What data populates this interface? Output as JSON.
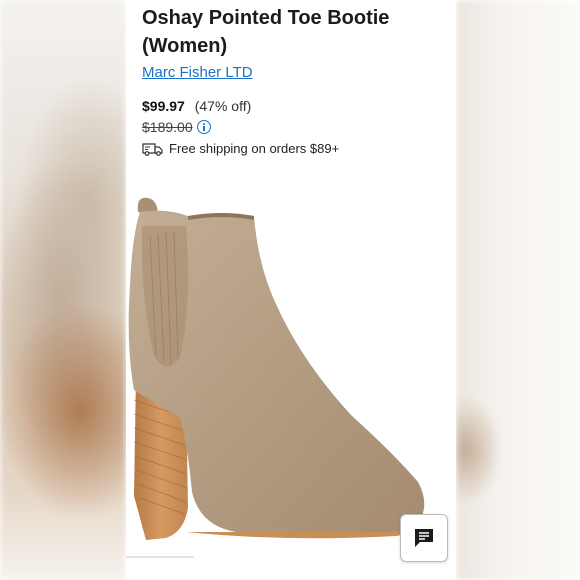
{
  "product": {
    "title": "Oshay Pointed Toe Bootie (Women)",
    "brand": "Marc Fisher LTD",
    "price": "$99.97",
    "discount": "(47% off)",
    "original_price": "$189.00",
    "shipping": "Free shipping on orders $89+"
  },
  "icons": {
    "info": "info-circle-icon",
    "shipping": "truck-icon",
    "chat": "chat-bubble-icon"
  },
  "colors": {
    "link": "#1a73c8",
    "suede": "#b59e84",
    "heel": "#c18856"
  }
}
